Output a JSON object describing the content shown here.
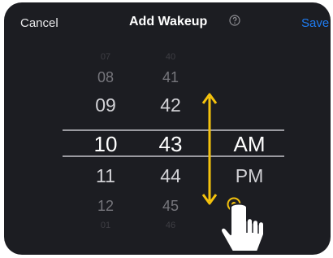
{
  "nav": {
    "cancel_label": "Cancel",
    "title": "Add Wakeup",
    "help_icon": "question-circle-icon",
    "save_label": "Save"
  },
  "picker": {
    "hours": [
      "07",
      "08",
      "09",
      "10",
      "11",
      "12",
      "01"
    ],
    "minutes": [
      "40",
      "41",
      "42",
      "43",
      "44",
      "45",
      "46"
    ],
    "periods": [
      "AM",
      "PM"
    ],
    "selected": {
      "hour": "10",
      "minute": "43",
      "period": "AM"
    }
  },
  "gesture": {
    "type": "vertical-swipe",
    "arrow_icon": "double-arrow-vertical-icon",
    "hand_icon": "pointing-hand-icon"
  },
  "colors": {
    "background": "#1c1d22",
    "text": "#ffffff",
    "accent": "#1e7cf2",
    "gesture": "#f4c20d"
  }
}
